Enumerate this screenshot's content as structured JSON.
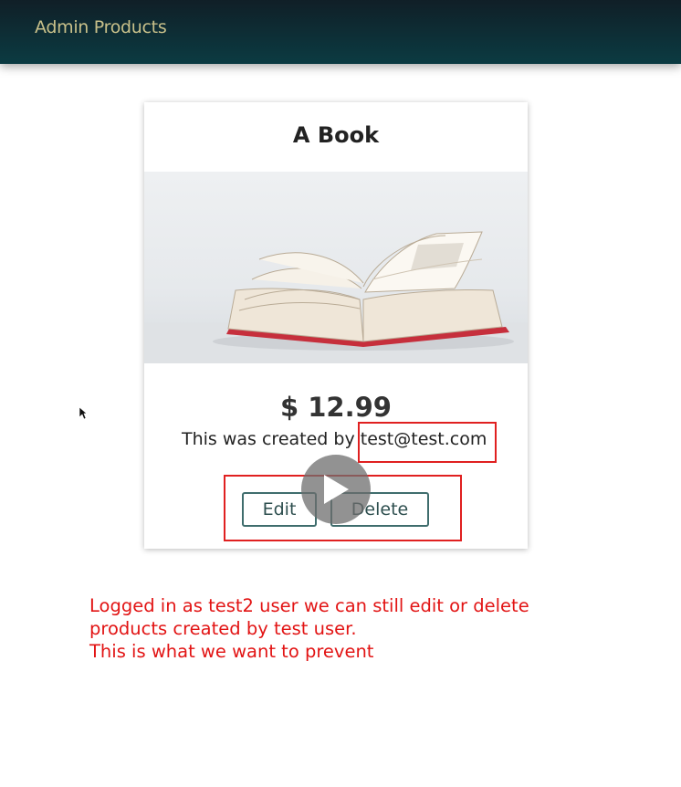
{
  "header": {
    "title": "Admin Products"
  },
  "product": {
    "title": "A Book",
    "price": "$ 12.99",
    "created_prefix": "This was created by ",
    "created_email": "test@test.com",
    "image_subject": "open-book-image"
  },
  "actions": {
    "edit_label": "Edit",
    "delete_label": "Delete"
  },
  "annotation": {
    "lines": [
      "Logged in as test2 user we can still edit or delete",
      "products created by test user.",
      "This is what we want to prevent"
    ]
  },
  "colors": {
    "header_bg": "#0b3b42",
    "header_text": "#c8c08a",
    "button_border": "#3f6d6d",
    "annotation_red": "#e21414"
  }
}
